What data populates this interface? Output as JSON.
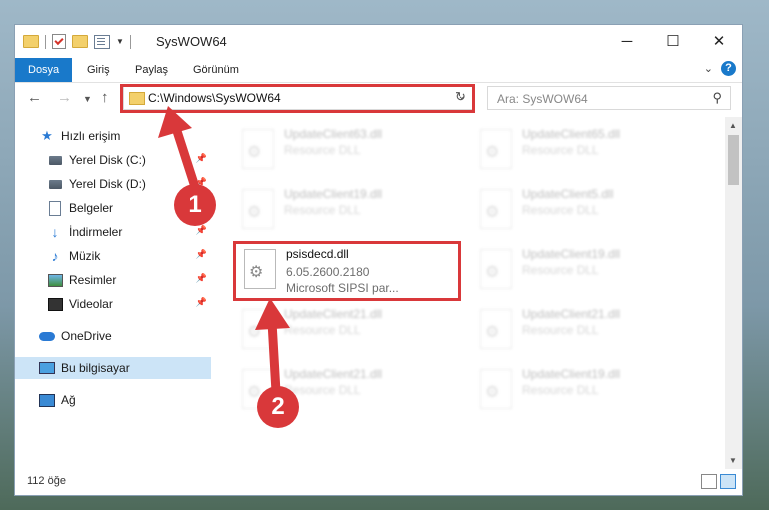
{
  "window": {
    "title": "SysWOW64",
    "controls": [
      "─",
      "☐",
      "✕"
    ]
  },
  "ribbon": {
    "tabs": [
      "Dosya",
      "Giriş",
      "Paylaş",
      "Görünüm"
    ],
    "active_tab": "Dosya"
  },
  "navigation": {
    "address": "C:\\Windows\\SysWOW64",
    "search_placeholder": "Ara: SysWOW64"
  },
  "sidebar": {
    "items": [
      {
        "label": "Hızlı erişim",
        "icon": "star-icon",
        "pinned": false
      },
      {
        "label": "Yerel Disk (C:)",
        "icon": "drive-icon",
        "pinned": true
      },
      {
        "label": "Yerel Disk (D:)",
        "icon": "drive-icon",
        "pinned": true
      },
      {
        "label": "Belgeler",
        "icon": "documents-icon",
        "pinned": true
      },
      {
        "label": "İndirmeler",
        "icon": "download-icon",
        "pinned": true
      },
      {
        "label": "Müzik",
        "icon": "music-icon",
        "pinned": true
      },
      {
        "label": "Resimler",
        "icon": "pictures-icon",
        "pinned": true
      },
      {
        "label": "Videolar",
        "icon": "videos-icon",
        "pinned": true
      },
      {
        "label": "OneDrive",
        "icon": "cloud-icon",
        "pinned": false
      },
      {
        "label": "Bu bilgisayar",
        "icon": "computer-icon",
        "pinned": false
      },
      {
        "label": "Ağ",
        "icon": "network-icon",
        "pinned": false
      }
    ],
    "selected": "Bu bilgisayar"
  },
  "files": [
    {
      "name": "UpdateClient63.dll",
      "line1": "Resource DLL",
      "line2": ""
    },
    {
      "name": "UpdateClient65.dll",
      "line1": "Resource DLL",
      "line2": ""
    },
    {
      "name": "UpdateClient19.dll",
      "line1": "Resource DLL",
      "line2": ""
    },
    {
      "name": "UpdateClient5.dll",
      "line1": "Resource DLL",
      "line2": ""
    },
    {
      "name": "psisdecd.dll",
      "line1": "6.05.2600.2180",
      "line2": "Microsoft SIPSI par..."
    },
    {
      "name": "UpdateClient19.dll",
      "line1": "Resource DLL",
      "line2": ""
    },
    {
      "name": "UpdateClient21.dll",
      "line1": "Resource DLL",
      "line2": ""
    },
    {
      "name": "UpdateClient21.dll",
      "line1": "Resource DLL",
      "line2": ""
    },
    {
      "name": "UpdateClient21.dll",
      "line1": "Resource DLL",
      "line2": ""
    },
    {
      "name": "UpdateClient19.dll",
      "line1": "Resource DLL",
      "line2": ""
    }
  ],
  "status": {
    "item_count": "112 öğe"
  },
  "annotations": {
    "step1": "1",
    "step2": "2",
    "color": "#d9383a"
  }
}
